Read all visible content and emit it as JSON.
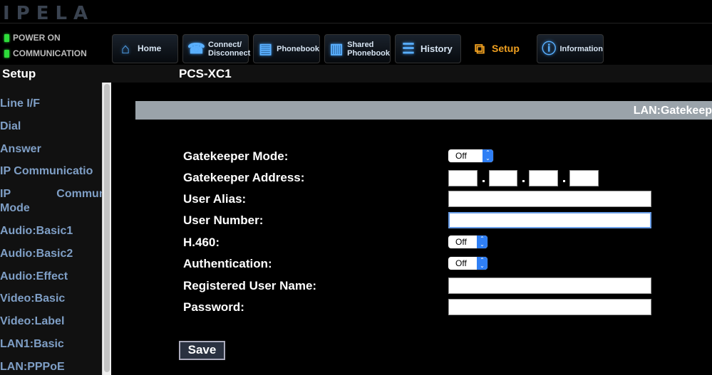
{
  "header": {
    "logo": "IPELA",
    "status": [
      "POWER ON",
      "COMMUNICATION"
    ],
    "status_color": "#2ddc3a"
  },
  "nav": [
    {
      "label": "Home",
      "icon": "home-icon"
    },
    {
      "label": "Connect/\nDisconnect",
      "l1": "Connect/",
      "l2": "Disconnect",
      "icon": "phone-icon"
    },
    {
      "label": "Phonebook",
      "icon": "phonebook-icon"
    },
    {
      "label": "Shared Phonebook",
      "l1": "Shared",
      "l2": "Phonebook",
      "icon": "shared-phonebook-icon"
    },
    {
      "label": "History",
      "icon": "history-icon"
    },
    {
      "label": "Setup",
      "icon": "toolbox-icon",
      "active": true
    },
    {
      "label": "Information",
      "icon": "info-icon"
    }
  ],
  "titlebar": {
    "section": "Setup",
    "device": "PCS-XC1"
  },
  "sidebar": [
    "Line I/F",
    "Dial",
    "Answer",
    "IP Communicatio",
    "IP Communicatio Mode",
    "Audio:Basic1",
    "Audio:Basic2",
    "Audio:Effect",
    "Video:Basic",
    "Video:Label",
    "LAN1:Basic",
    "LAN:PPPoE"
  ],
  "form": {
    "heading": "LAN:Gatekeep",
    "labels": [
      "Gatekeeper Mode:",
      "Gatekeeper Address:",
      "User Alias:",
      "User Number:",
      "H.460:",
      "Authentication:",
      "Registered User Name:",
      "Password:"
    ],
    "gatekeeper_mode": "Off",
    "h460": "Off",
    "authentication": "Off",
    "gatekeeper_address": [
      "",
      "",
      "",
      ""
    ],
    "user_alias": "",
    "user_number": "",
    "registered_user_name": "",
    "password": "",
    "save": "Save"
  },
  "colors": {
    "accent": "#f0a020",
    "sidebar_text": "#7f9fc6",
    "section_bar": "#9aa3aa"
  }
}
